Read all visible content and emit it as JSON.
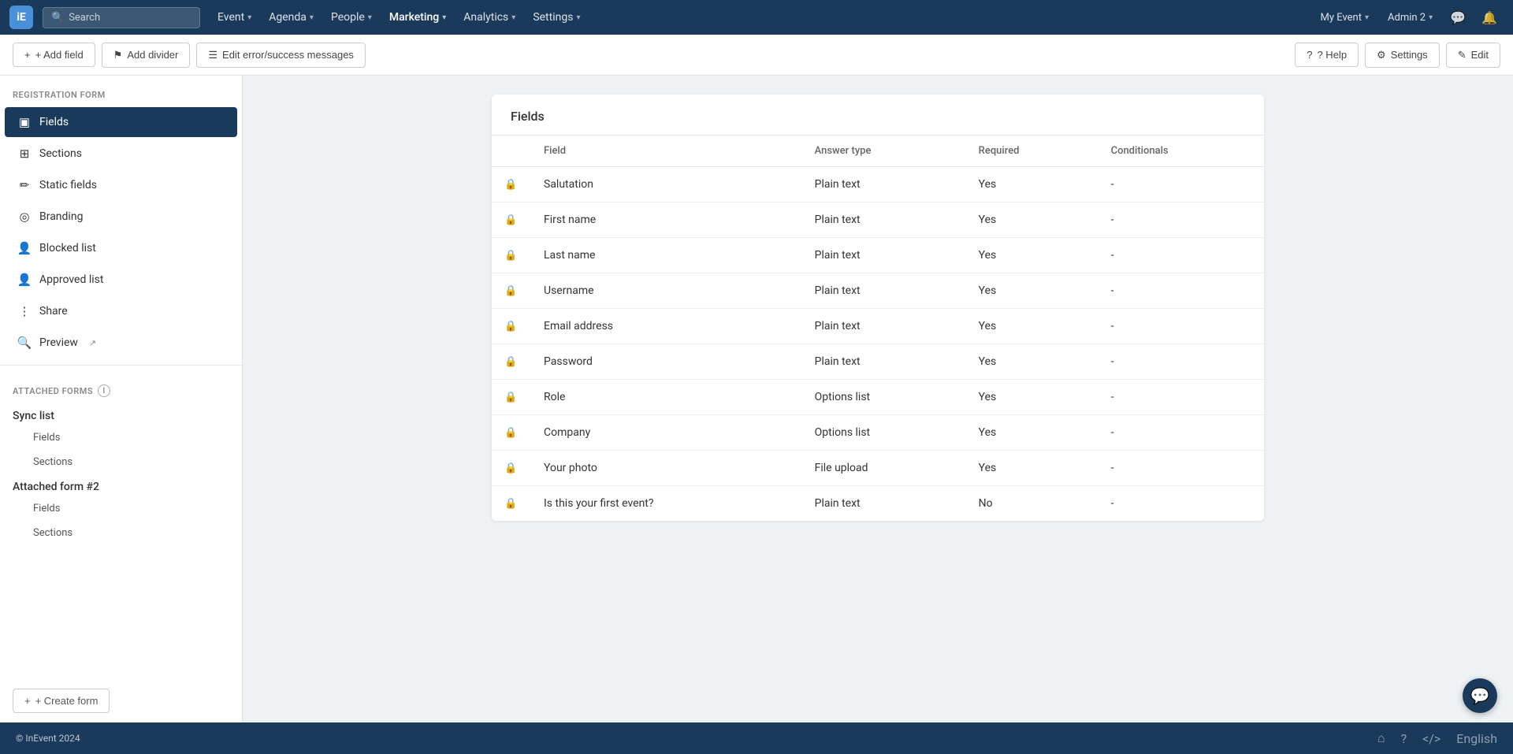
{
  "app": {
    "logo_text": "iE",
    "copyright": "© InEvent 2024",
    "language": "English"
  },
  "topnav": {
    "search_placeholder": "Search",
    "items": [
      {
        "label": "Event",
        "has_dropdown": true
      },
      {
        "label": "Agenda",
        "has_dropdown": true
      },
      {
        "label": "People",
        "has_dropdown": true
      },
      {
        "label": "Marketing",
        "has_dropdown": true,
        "active": true
      },
      {
        "label": "Analytics",
        "has_dropdown": true
      },
      {
        "label": "Settings",
        "has_dropdown": true
      }
    ],
    "right_items": [
      {
        "label": "My Event",
        "has_dropdown": true
      },
      {
        "label": "Admin 2",
        "has_dropdown": true
      }
    ],
    "icon_chat": "💬",
    "icon_bell": "🔔"
  },
  "toolbar": {
    "add_field_label": "+ Add field",
    "add_divider_label": "⚑ Add divider",
    "edit_messages_label": "☰ Edit error/success messages",
    "help_label": "? Help",
    "settings_label": "⚙ Settings",
    "edit_label": "✎ Edit"
  },
  "sidebar": {
    "registration_form_title": "REGISTRATION FORM",
    "items": [
      {
        "id": "fields",
        "label": "Fields",
        "icon": "▣",
        "active": true
      },
      {
        "id": "sections",
        "label": "Sections",
        "icon": "⊞"
      },
      {
        "id": "static-fields",
        "label": "Static fields",
        "icon": "✏"
      },
      {
        "id": "branding",
        "label": "Branding",
        "icon": "◎"
      },
      {
        "id": "blocked-list",
        "label": "Blocked list",
        "icon": "👤"
      },
      {
        "id": "approved-list",
        "label": "Approved list",
        "icon": "👤"
      },
      {
        "id": "share",
        "label": "Share",
        "icon": "⋮"
      },
      {
        "id": "preview",
        "label": "Preview",
        "icon": "🔍"
      }
    ],
    "attached_forms_title": "ATTACHED FORMS",
    "attached_forms": [
      {
        "name": "Sync list",
        "sub_items": [
          "Fields",
          "Sections"
        ]
      },
      {
        "name": "Attached form #2",
        "sub_items": [
          "Fields",
          "Sections"
        ]
      }
    ],
    "create_form_label": "+ Create form"
  },
  "fields_card": {
    "title": "Fields",
    "columns": [
      {
        "label": "Field"
      },
      {
        "label": "Answer type"
      },
      {
        "label": "Required"
      },
      {
        "label": "Conditionals"
      }
    ],
    "rows": [
      {
        "field": "Salutation",
        "answer_type": "Plain text",
        "required": "Yes",
        "conditionals": "-",
        "locked": true
      },
      {
        "field": "First name",
        "answer_type": "Plain text",
        "required": "Yes",
        "conditionals": "-",
        "locked": true
      },
      {
        "field": "Last name",
        "answer_type": "Plain text",
        "required": "Yes",
        "conditionals": "-",
        "locked": true
      },
      {
        "field": "Username",
        "answer_type": "Plain text",
        "required": "Yes",
        "conditionals": "-",
        "locked": true
      },
      {
        "field": "Email address",
        "answer_type": "Plain text",
        "required": "Yes",
        "conditionals": "-",
        "locked": true
      },
      {
        "field": "Password",
        "answer_type": "Plain text",
        "required": "Yes",
        "conditionals": "-",
        "locked": true
      },
      {
        "field": "Role",
        "answer_type": "Options list",
        "required": "Yes",
        "conditionals": "-",
        "locked": true
      },
      {
        "field": "Company",
        "answer_type": "Options list",
        "required": "Yes",
        "conditionals": "-",
        "locked": true
      },
      {
        "field": "Your photo",
        "answer_type": "File upload",
        "required": "Yes",
        "conditionals": "-",
        "locked": true
      },
      {
        "field": "Is this your first event?",
        "answer_type": "Plain text",
        "required": "No",
        "conditionals": "-",
        "locked": true
      }
    ]
  }
}
